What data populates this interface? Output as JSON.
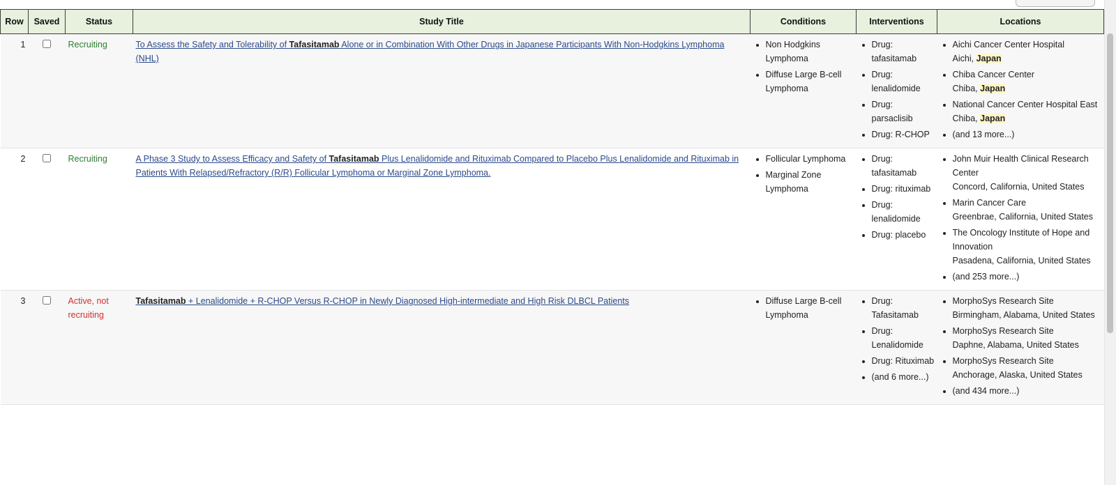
{
  "table": {
    "headers": {
      "row": "Row",
      "saved": "Saved",
      "status": "Status",
      "title": "Study Title",
      "conditions": "Conditions",
      "interventions": "Interventions",
      "locations": "Locations"
    },
    "rows": [
      {
        "row": "1",
        "saved": false,
        "status": "Recruiting",
        "title": {
          "pre": "To Assess the Safety and Tolerability of ",
          "bold": "Tafasitamab",
          "post": " Alone or in Combination With Other Drugs in Japanese Participants With Non-Hodgkins Lymphoma (NHL)"
        },
        "conditions": [
          "Non Hodgkins Lymphoma",
          "Diffuse Large B-cell Lymphoma"
        ],
        "interventions": [
          "Drug: tafasitamab",
          "Drug: lenalidomide",
          "Drug: parsaclisib",
          "Drug: R-CHOP"
        ],
        "locations": [
          {
            "name": "Aichi Cancer Center Hospital",
            "city": "Aichi,",
            "country": "Japan"
          },
          {
            "name": "Chiba Cancer Center",
            "city": "Chiba,",
            "country": "Japan"
          },
          {
            "name": "National Cancer Center Hospital East",
            "city": "Chiba,",
            "country": "Japan"
          },
          {
            "more": "(and 13 more...)"
          }
        ]
      },
      {
        "row": "2",
        "saved": false,
        "status": "Recruiting",
        "title": {
          "pre": "A Phase 3 Study to Assess Efficacy and Safety of ",
          "bold": "Tafasitamab",
          "post": " Plus Lenalidomide and Rituximab Compared to Placebo Plus Lenalidomide and Rituximab in Patients With Relapsed/Refractory (R/R) Follicular Lymphoma or Marginal Zone Lymphoma."
        },
        "conditions": [
          "Follicular Lymphoma",
          "Marginal Zone Lymphoma"
        ],
        "interventions": [
          "Drug: tafasitamab",
          "Drug: rituximab",
          "Drug: lenalidomide",
          "Drug: placebo"
        ],
        "locations": [
          {
            "name": "John Muir Health Clinical Research Center",
            "city": "Concord, California, United States"
          },
          {
            "name": "Marin Cancer Care",
            "city": "Greenbrae, California, United States"
          },
          {
            "name": "The Oncology Institute of Hope and Innovation",
            "city": "Pasadena, California, United States"
          },
          {
            "more": "(and 253 more...)"
          }
        ]
      },
      {
        "row": "3",
        "saved": false,
        "status": "Active, not recruiting",
        "title": {
          "pre": "",
          "bold": "Tafasitamab",
          "post": " + Lenalidomide + R-CHOP Versus R-CHOP in Newly Diagnosed High-intermediate and High Risk DLBCL Patients"
        },
        "conditions": [
          "Diffuse Large B-cell Lymphoma"
        ],
        "interventions": [
          "Drug: Tafasitamab",
          "Drug: Lenalidomide",
          "Drug: Rituximab",
          "(and 6 more...)"
        ],
        "locations": [
          {
            "name": "MorphoSys Research Site",
            "city": "Birmingham, Alabama, United States"
          },
          {
            "name": "MorphoSys Research Site",
            "city": "Daphne, Alabama, United States"
          },
          {
            "name": "MorphoSys Research Site",
            "city": "Anchorage, Alaska, United States"
          },
          {
            "more": "(and 434 more...)"
          }
        ]
      }
    ]
  },
  "colors": {
    "header_bg": "#e7f1de",
    "recruiting": "#2e7d32",
    "active_not_recruiting": "#d32f2f",
    "link": "#2b4a8b",
    "highlight": "#fdf6c9"
  }
}
